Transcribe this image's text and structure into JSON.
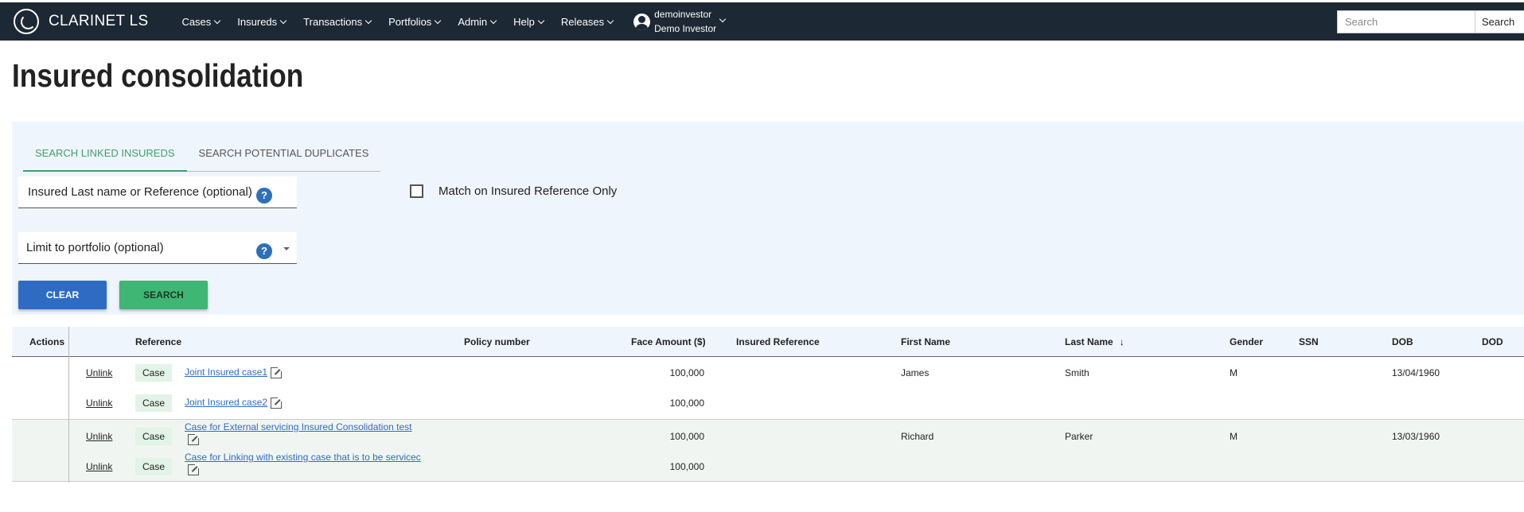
{
  "brand": "CLARINET LS",
  "nav": [
    "Cases",
    "Insureds",
    "Transactions",
    "Portfolios",
    "Admin",
    "Help",
    "Releases"
  ],
  "user": {
    "username": "demoinvestor",
    "display_name": "Demo Investor"
  },
  "search": {
    "placeholder": "Search",
    "button": "Search"
  },
  "page_title": "Insured consolidation",
  "tabs": [
    "SEARCH LINKED INSUREDS",
    "SEARCH POTENTIAL DUPLICATES"
  ],
  "filters": {
    "last_name_placeholder": "Insured Last name or Reference (optional)",
    "portfolio_placeholder": "Limit to portfolio (optional)",
    "help_glyph": "?",
    "match_label": "Match on Insured Reference Only"
  },
  "buttons": {
    "clear": "CLEAR",
    "search": "SEARCH"
  },
  "table": {
    "columns": [
      "Actions",
      "Reference",
      "Policy number",
      "Face Amount ($)",
      "Insured Reference",
      "First Name",
      "Last Name",
      "Gender",
      "SSN",
      "DOB",
      "DOD"
    ],
    "sort_glyph": "↓",
    "rows": [
      {
        "action": "Unlink",
        "type": "Case",
        "reference": "Joint Insured case1",
        "face_amount": "100,000",
        "first_name": "James",
        "last_name": "Smith",
        "gender": "M",
        "dob": "13/04/1960"
      },
      {
        "action": "Unlink",
        "type": "Case",
        "reference": "Joint Insured case2",
        "face_amount": "100,000",
        "first_name": "",
        "last_name": "",
        "gender": "",
        "dob": ""
      },
      {
        "action": "Unlink",
        "type": "Case",
        "reference": "Case for External servicing Insured Consolidation test",
        "face_amount": "100,000",
        "first_name": "Richard",
        "last_name": "Parker",
        "gender": "M",
        "dob": "13/03/1960"
      },
      {
        "action": "Unlink",
        "type": "Case",
        "reference": "Case for Linking with existing case that is to be servicec",
        "face_amount": "100,000",
        "first_name": "",
        "last_name": "",
        "gender": "",
        "dob": ""
      }
    ]
  }
}
